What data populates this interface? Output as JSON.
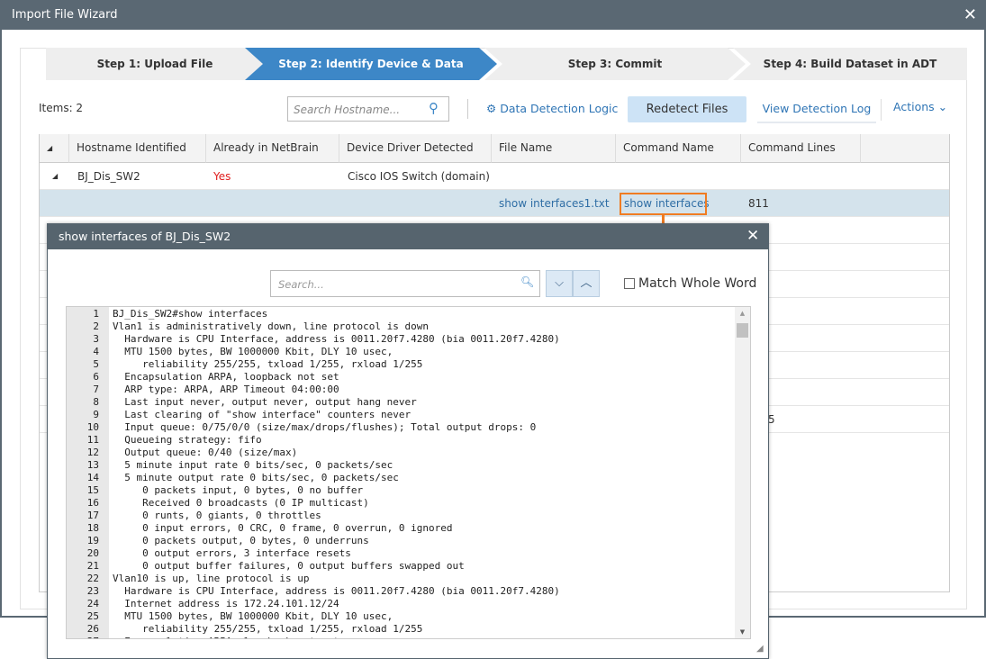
{
  "window": {
    "title": "Import File Wizard",
    "close_icon": "close-icon"
  },
  "steps": [
    {
      "label": "Step 1: Upload File",
      "active": false
    },
    {
      "label": "Step 2: Identify Device & Data",
      "active": true
    },
    {
      "label": "Step 3: Commit",
      "active": false
    },
    {
      "label": "Step 4: Build Dataset in ADT",
      "active": false
    }
  ],
  "toolbar": {
    "items_count": "Items: 2",
    "search_placeholder": "Search Hostname...",
    "data_detection_logic": "Data Detection Logic",
    "redetect_files": "Redetect Files",
    "view_detection_log": "View Detection Log",
    "actions": "Actions"
  },
  "table": {
    "headers": [
      "Hostname Identified",
      "Already in NetBrain",
      "Device Driver Detected",
      "File Name",
      "Command Name",
      "Command Lines"
    ],
    "group": {
      "hostname": "BJ_Dis_SW2",
      "already": "Yes",
      "driver": "Cisco IOS Switch (domain)"
    },
    "selected_row": {
      "file_name": "show interfaces1.txt",
      "command_name": "show interfaces",
      "command_lines": "811"
    },
    "partial_cell": "5"
  },
  "popup": {
    "title": "show interfaces of BJ_Dis_SW2",
    "search_placeholder": "Search...",
    "match_whole_word": "Match Whole Word",
    "match_whole_word_checked": false,
    "lines": [
      "BJ_Dis_SW2#show interfaces",
      "Vlan1 is administratively down, line protocol is down",
      "  Hardware is CPU Interface, address is 0011.20f7.4280 (bia 0011.20f7.4280)",
      "  MTU 1500 bytes, BW 1000000 Kbit, DLY 10 usec,",
      "     reliability 255/255, txload 1/255, rxload 1/255",
      "  Encapsulation ARPA, loopback not set",
      "  ARP type: ARPA, ARP Timeout 04:00:00",
      "  Last input never, output never, output hang never",
      "  Last clearing of \"show interface\" counters never",
      "  Input queue: 0/75/0/0 (size/max/drops/flushes); Total output drops: 0",
      "  Queueing strategy: fifo",
      "  Output queue: 0/40 (size/max)",
      "  5 minute input rate 0 bits/sec, 0 packets/sec",
      "  5 minute output rate 0 bits/sec, 0 packets/sec",
      "     0 packets input, 0 bytes, 0 no buffer",
      "     Received 0 broadcasts (0 IP multicast)",
      "     0 runts, 0 giants, 0 throttles",
      "     0 input errors, 0 CRC, 0 frame, 0 overrun, 0 ignored",
      "     0 packets output, 0 bytes, 0 underruns",
      "     0 output errors, 3 interface resets",
      "     0 output buffer failures, 0 output buffers swapped out",
      "Vlan10 is up, line protocol is up",
      "  Hardware is CPU Interface, address is 0011.20f7.4280 (bia 0011.20f7.4280)",
      "  Internet address is 172.24.101.12/24",
      "  MTU 1500 bytes, BW 1000000 Kbit, DLY 10 usec,",
      "     reliability 255/255, txload 1/255, rxload 1/255",
      "  Encapsulation ARPA, loopback not set"
    ]
  },
  "colors": {
    "accent": "#3d87c7",
    "titlebar": "#5a6873",
    "highlight": "#f07c22",
    "selected_row": "#d4e3ec",
    "yes": "#e02020"
  }
}
